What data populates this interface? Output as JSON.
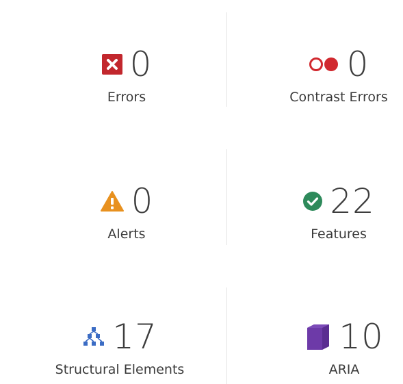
{
  "summary": {
    "errors": {
      "count": "0",
      "label": "Errors",
      "icon": "error-x-icon",
      "color": "#c2272d"
    },
    "contrast_errors": {
      "count": "0",
      "label": "Contrast Errors",
      "icon": "contrast-circles-icon",
      "color": "#d1292f"
    },
    "alerts": {
      "count": "0",
      "label": "Alerts",
      "icon": "alert-triangle-icon",
      "color": "#e8911f"
    },
    "features": {
      "count": "22",
      "label": "Features",
      "icon": "check-circle-icon",
      "color": "#2e8a5b"
    },
    "structural_elements": {
      "count": "17",
      "label": "Structural Elements",
      "icon": "structure-tree-icon",
      "color": "#3b6cc4"
    },
    "aria": {
      "count": "10",
      "label": "ARIA",
      "icon": "aria-cube-icon",
      "color": "#5a2d91"
    }
  }
}
